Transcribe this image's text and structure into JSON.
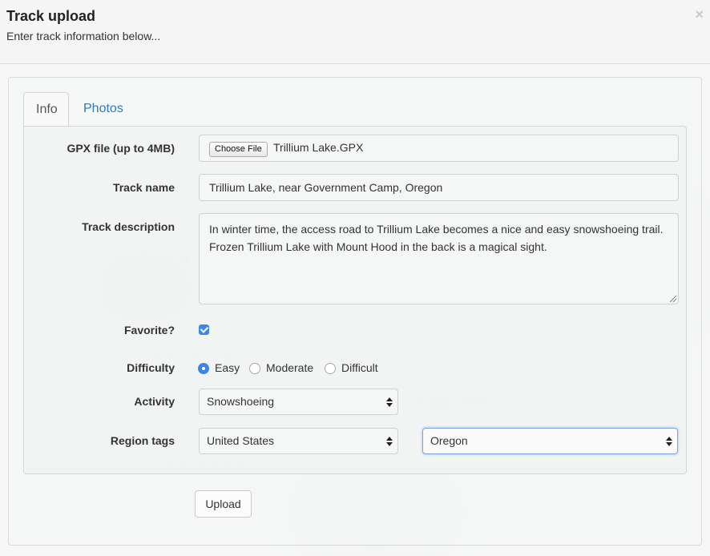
{
  "modal": {
    "title": "Track upload",
    "subtitle": "Enter track information below...",
    "close_icon": "close-icon"
  },
  "tabs": [
    {
      "label": "Info",
      "active": true
    },
    {
      "label": "Photos",
      "active": false
    }
  ],
  "form": {
    "gpx_file": {
      "label": "GPX file (up to 4MB)",
      "button_label": "Choose File",
      "file_name": "Trillium Lake.GPX"
    },
    "track_name": {
      "label": "Track name",
      "value": "Trillium Lake, near Government Camp, Oregon"
    },
    "track_description": {
      "label": "Track description",
      "value": "In winter time, the access road to Trillium Lake becomes a nice and easy snowshoeing trail. Frozen Trillium Lake with Mount Hood in the back is a magical sight."
    },
    "favorite": {
      "label": "Favorite?",
      "checked": true
    },
    "difficulty": {
      "label": "Difficulty",
      "options": [
        {
          "label": "Easy",
          "selected": true
        },
        {
          "label": "Moderate",
          "selected": false
        },
        {
          "label": "Difficult",
          "selected": false
        }
      ]
    },
    "activity": {
      "label": "Activity",
      "value": "Snowshoeing"
    },
    "region_tags": {
      "label": "Region tags",
      "country": "United States",
      "state": "Oregon"
    }
  },
  "upload_button": {
    "label": "Upload"
  },
  "colors": {
    "accent": "#3b86e8",
    "link": "#337ab7"
  }
}
